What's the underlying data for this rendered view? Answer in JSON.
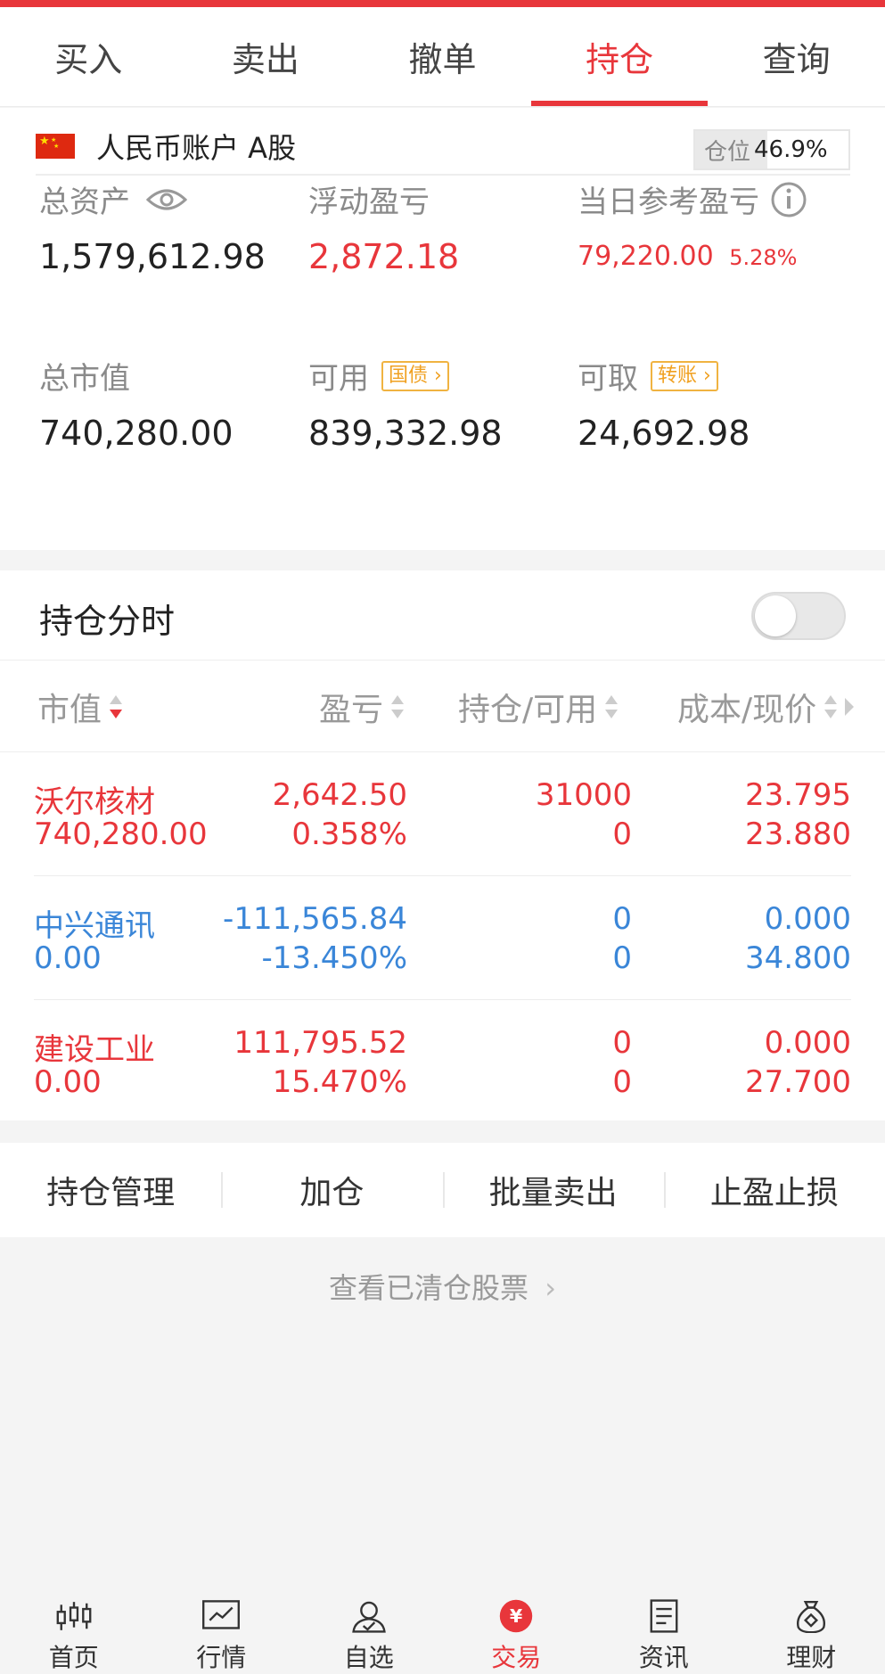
{
  "tabs": [
    "买入",
    "卖出",
    "撤单",
    "持仓",
    "查询"
  ],
  "active_tab": 3,
  "account": {
    "name": "人民币账户 A股",
    "position_label": "仓位",
    "position_value": "46.9%",
    "position_fraction": 0.469
  },
  "summary": {
    "total_assets_label": "总资产",
    "total_assets": "1,579,612.98",
    "float_pl_label": "浮动盈亏",
    "float_pl": "2,872.18",
    "day_pl_label": "当日参考盈亏",
    "day_pl": "79,220.00",
    "day_pl_pct": "5.28%",
    "market_value_label": "总市值",
    "market_value": "740,280.00",
    "available_label": "可用",
    "available_badge": "国债",
    "available": "839,332.98",
    "withdrawable_label": "可取",
    "withdrawable_badge": "转账",
    "withdrawable": "24,692.98"
  },
  "holdings": {
    "title": "持仓分时",
    "columns": [
      "市值",
      "盈亏",
      "持仓/可用",
      "成本/现价"
    ],
    "rows": [
      {
        "name": "沃尔核材",
        "market_value": "740,280.00",
        "pl": "2,642.50",
        "pl_pct": "0.358%",
        "hold": "31000",
        "avail": "0",
        "cost": "23.795",
        "price": "23.880",
        "color": "#e8363b"
      },
      {
        "name": "中兴通讯",
        "market_value": "0.00",
        "pl": "-111,565.84",
        "pl_pct": "-13.450%",
        "hold": "0",
        "avail": "0",
        "cost": "0.000",
        "price": "34.800",
        "color": "#3a86d8"
      },
      {
        "name": "建设工业",
        "market_value": "0.00",
        "pl": "111,795.52",
        "pl_pct": "15.470%",
        "hold": "0",
        "avail": "0",
        "cost": "0.000",
        "price": "27.700",
        "color": "#e8363b"
      }
    ]
  },
  "actions": [
    "持仓管理",
    "加仓",
    "批量卖出",
    "止盈止损"
  ],
  "cleared_link": "查看已清仓股票",
  "bottom_nav": [
    {
      "label": "首页",
      "icon": "candlestick-icon"
    },
    {
      "label": "行情",
      "icon": "chart-icon"
    },
    {
      "label": "自选",
      "icon": "person-check-icon"
    },
    {
      "label": "交易",
      "icon": "yen-icon"
    },
    {
      "label": "资讯",
      "icon": "document-icon"
    },
    {
      "label": "理财",
      "icon": "money-bag-icon"
    }
  ],
  "colors": {
    "accent": "#e8363b",
    "down": "#3a86d8",
    "badge": "#f0a020"
  }
}
